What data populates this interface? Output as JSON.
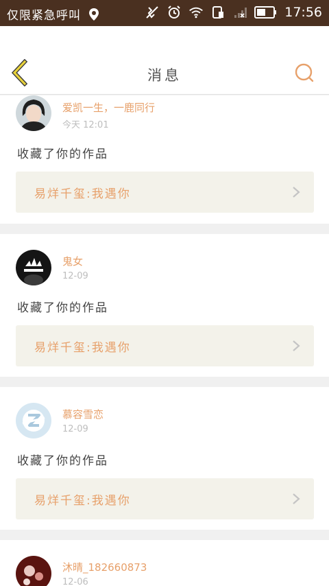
{
  "status_bar": {
    "carrier_text": "仅限紧急呼叫",
    "time": "17:56"
  },
  "header": {
    "title": "消息",
    "back_icon": "chevron-left-icon",
    "search_icon": "search-icon"
  },
  "messages": [
    {
      "user_name": "爱凯一生，一鹿同行",
      "time": "今天 12:01",
      "action": "收藏了你的作品",
      "work_title": "易烊千玺:我遇你"
    },
    {
      "user_name": "鬼女",
      "time": "12-09",
      "action": "收藏了你的作品",
      "work_title": "易烊千玺:我遇你"
    },
    {
      "user_name": "慕容雪恋",
      "time": "12-09",
      "action": "收藏了你的作品",
      "work_title": "易烊千玺:我遇你"
    },
    {
      "user_name": "沐晴_182660873",
      "time": "12-06"
    }
  ],
  "colors": {
    "accent": "#e7a06a",
    "back_arrow": "#e8d23c",
    "status_bar": "#4a3020",
    "work_box_bg": "#f3f2ea"
  }
}
